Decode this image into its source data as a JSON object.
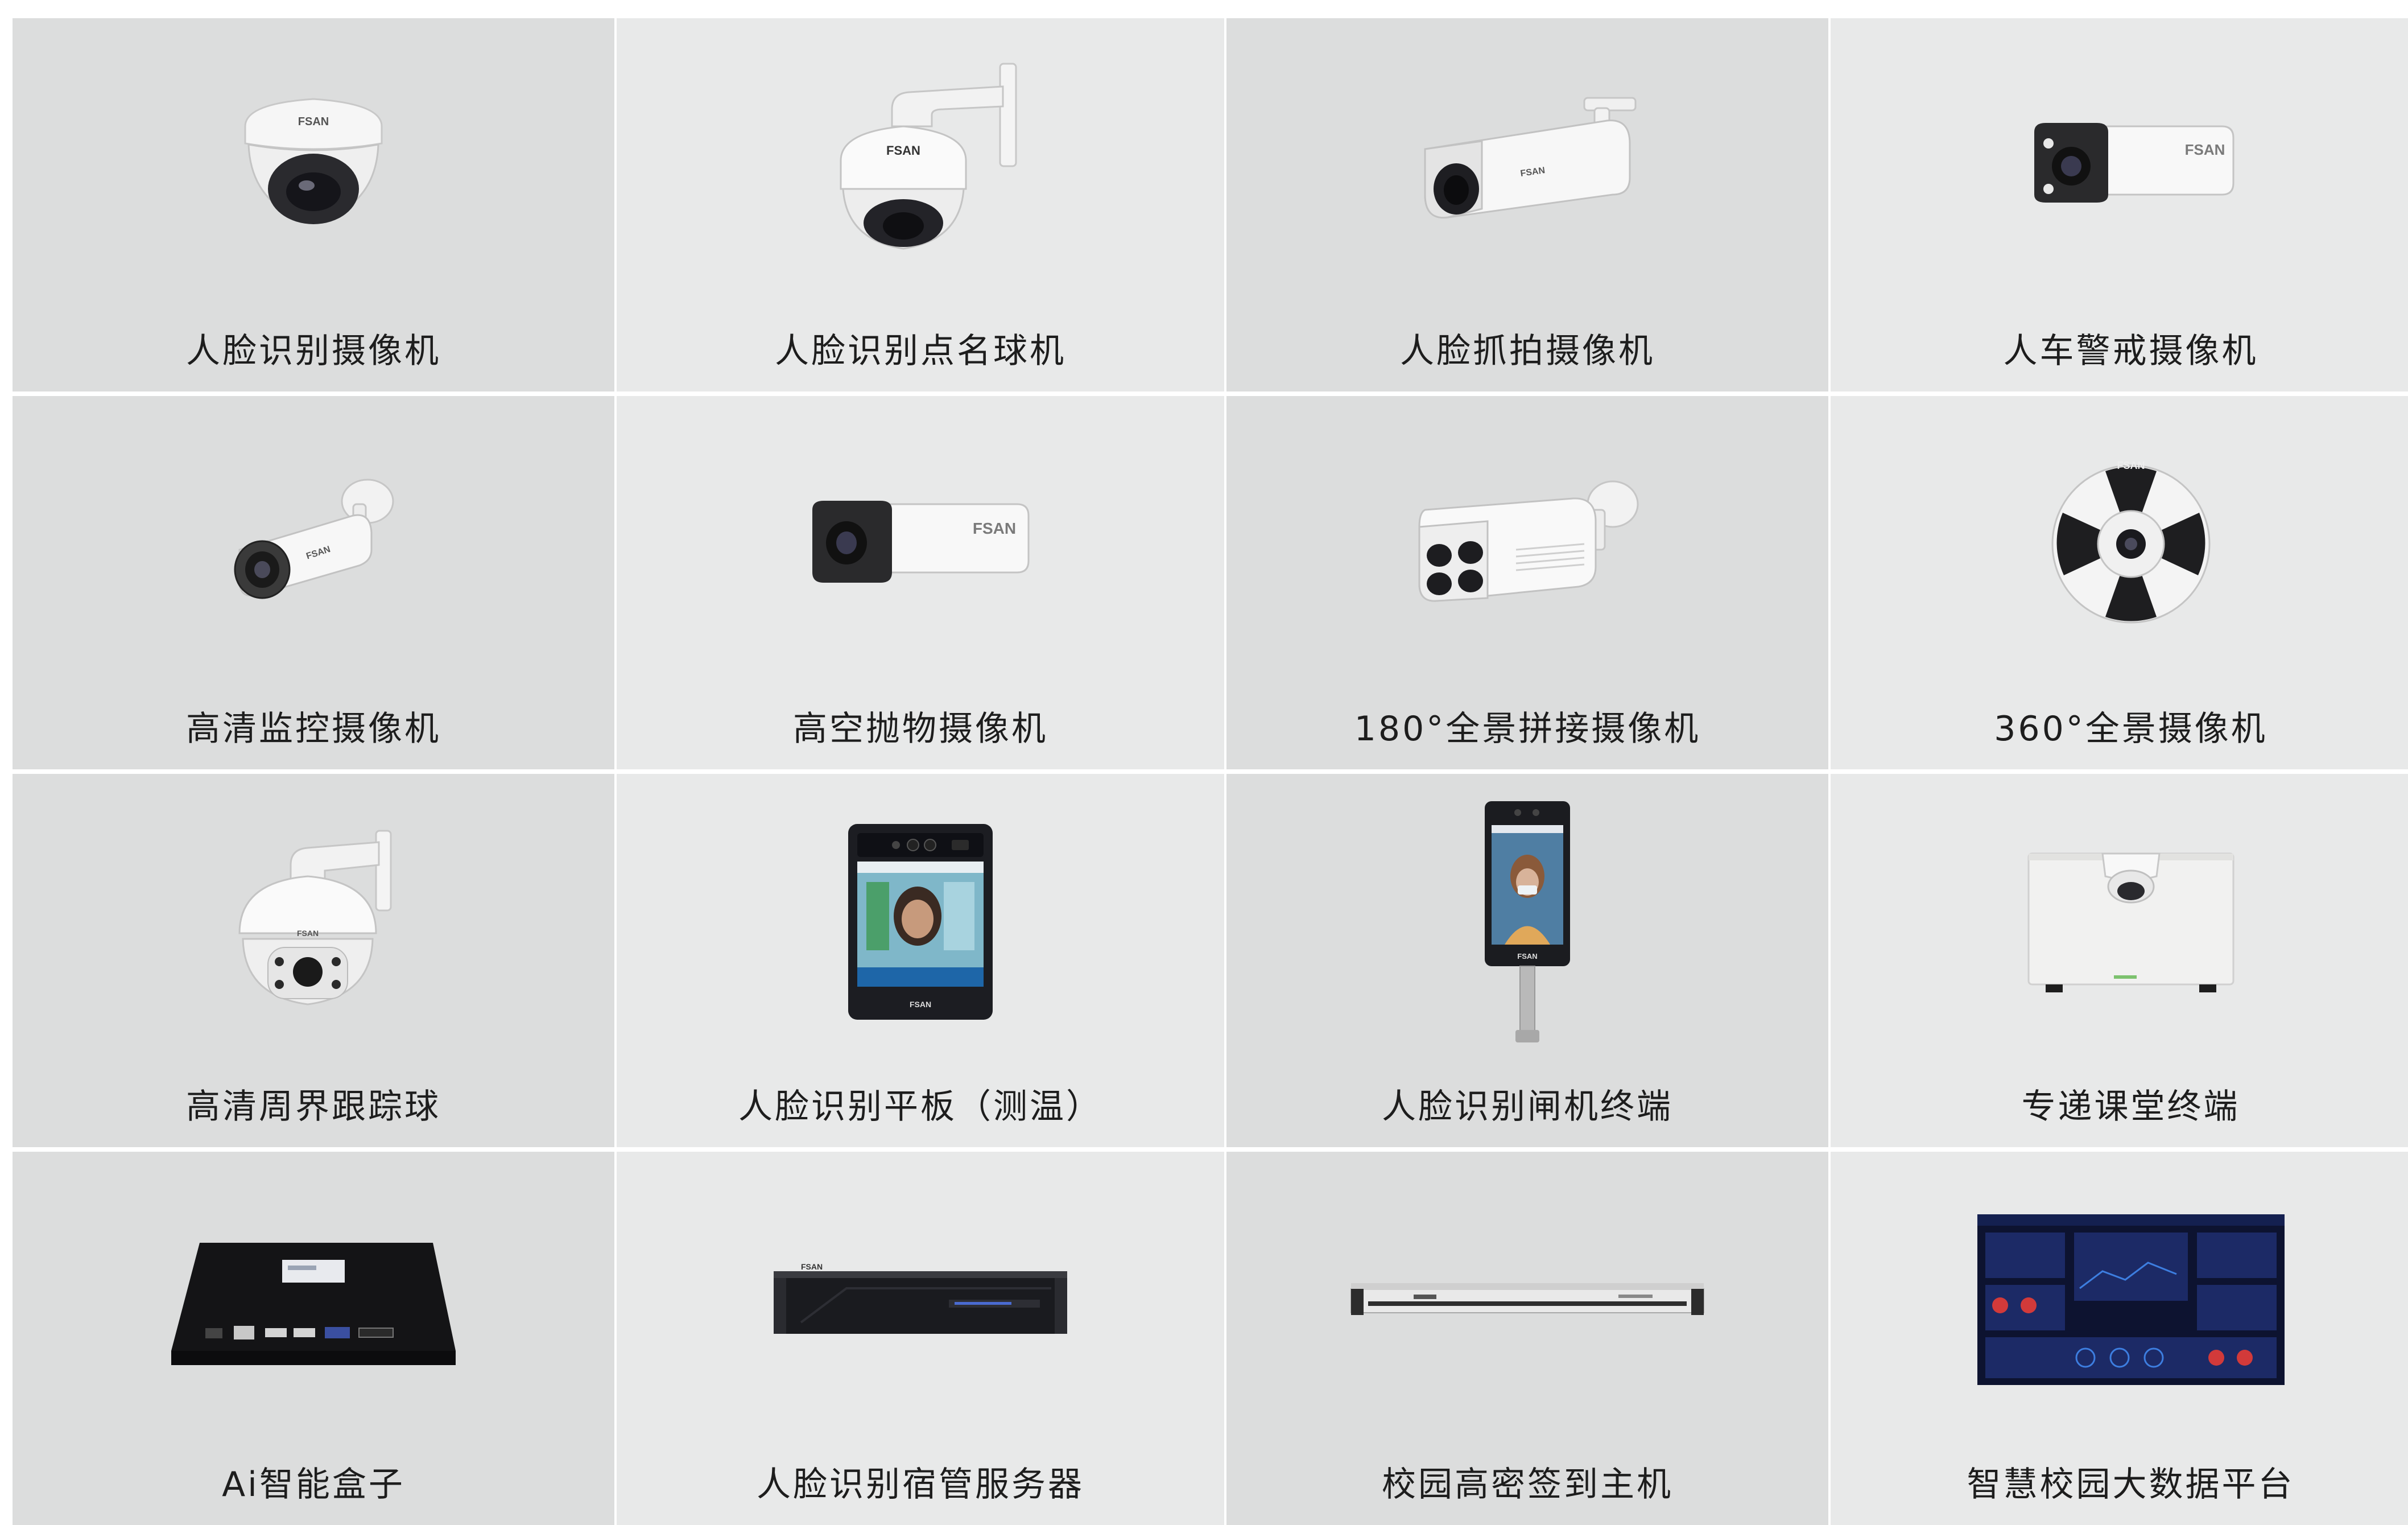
{
  "products": [
    {
      "label": "人脸识别摄像机",
      "icon": "dome-camera-icon"
    },
    {
      "label": "人脸识别点名球机",
      "icon": "wall-mount-dome-camera-icon"
    },
    {
      "label": "人脸抓拍摄像机",
      "icon": "bullet-camera-icon"
    },
    {
      "label": "人车警戒摄像机",
      "icon": "box-bullet-camera-icon"
    },
    {
      "label": "高清监控摄像机",
      "icon": "ir-bullet-camera-icon"
    },
    {
      "label": "高空抛物摄像机",
      "icon": "box-bullet-camera-icon"
    },
    {
      "label": "180°全景拼接摄像机",
      "icon": "multi-lens-panoramic-camera-icon"
    },
    {
      "label": "360°全景摄像机",
      "icon": "fisheye-camera-icon"
    },
    {
      "label": "高清周界跟踪球",
      "icon": "ptz-speed-dome-icon"
    },
    {
      "label": "人脸识别平板（测温）",
      "icon": "face-recognition-tablet-icon"
    },
    {
      "label": "人脸识别闸机终端",
      "icon": "face-gate-terminal-icon"
    },
    {
      "label": "专递课堂终端",
      "icon": "classroom-terminal-icon"
    },
    {
      "label": "Ai智能盒子",
      "icon": "ai-box-icon"
    },
    {
      "label": "人脸识别宿管服务器",
      "icon": "rack-server-icon"
    },
    {
      "label": "校园高密签到主机",
      "icon": "1u-rack-host-icon"
    },
    {
      "label": "智慧校园大数据平台",
      "icon": "dashboard-screen-icon"
    }
  ],
  "brand": "FSAN",
  "colors": {
    "cell_dark": "#dcdddd",
    "cell_light": "#e8e9e9",
    "label": "#1d1d1d"
  }
}
